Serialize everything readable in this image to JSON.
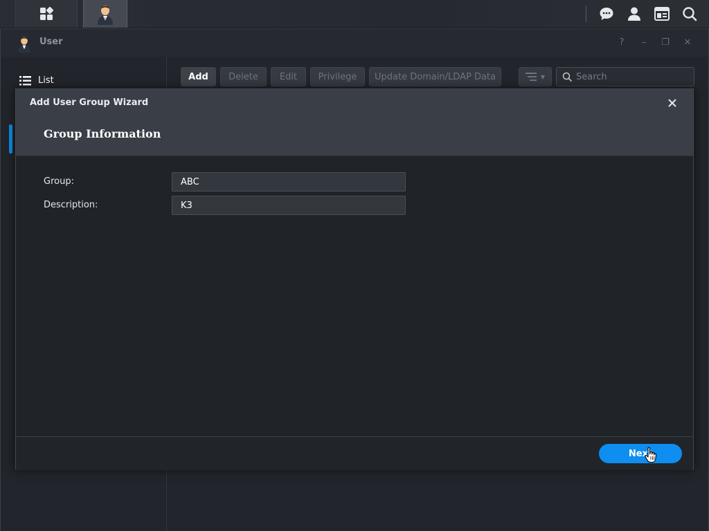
{
  "window": {
    "title": "User"
  },
  "sidebar": {
    "items": [
      {
        "label": "List"
      }
    ]
  },
  "toolbar": {
    "add_label": "Add",
    "delete_label": "Delete",
    "edit_label": "Edit",
    "privilege_label": "Privilege",
    "update_label": "Update Domain/LDAP Data",
    "search_placeholder": "Search"
  },
  "dialog": {
    "title": "Add User Group Wizard",
    "step_title": "Group Information",
    "fields": [
      {
        "label": "Group:",
        "value": "ABC"
      },
      {
        "label": "Description:",
        "value": "K3"
      }
    ],
    "next_label": "Next"
  },
  "colors": {
    "accent": "#0d8ef0",
    "background": "#22252b",
    "dialog_header": "#3a3e46"
  },
  "icons": [
    "apps-grid-icon",
    "user-avatar-icon",
    "chat-icon",
    "account-icon",
    "widgets-icon",
    "search-icon",
    "list-icon",
    "filter-icon",
    "close-icon",
    "hand-cursor-icon"
  ]
}
